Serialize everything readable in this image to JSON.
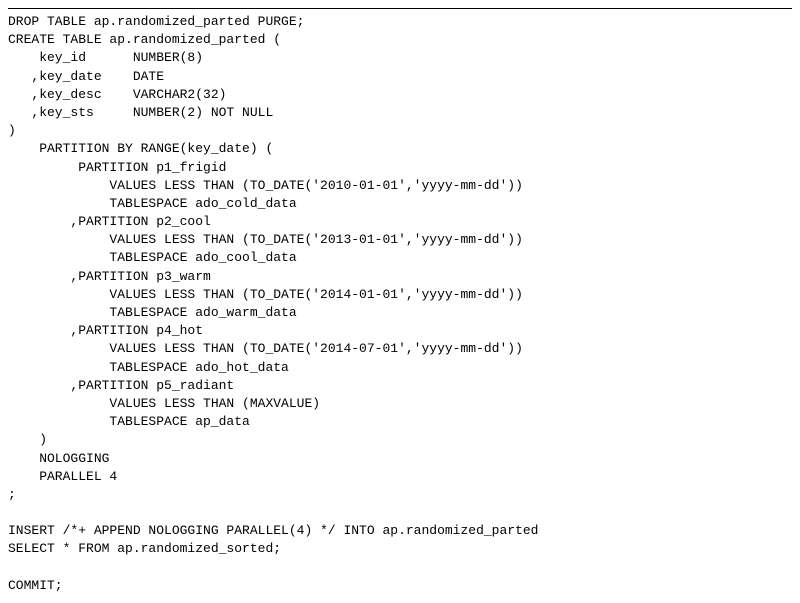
{
  "code": {
    "line01": "DROP TABLE ap.randomized_parted PURGE;",
    "line02": "CREATE TABLE ap.randomized_parted (",
    "line03": "    key_id      NUMBER(8)",
    "line04": "   ,key_date    DATE",
    "line05": "   ,key_desc    VARCHAR2(32)",
    "line06": "   ,key_sts     NUMBER(2) NOT NULL",
    "line07": ")",
    "line08": "    PARTITION BY RANGE(key_date) (",
    "line09": "         PARTITION p1_frigid",
    "line10": "             VALUES LESS THAN (TO_DATE('2010-01-01','yyyy-mm-dd'))",
    "line11": "             TABLESPACE ado_cold_data",
    "line12": "        ,PARTITION p2_cool",
    "line13": "             VALUES LESS THAN (TO_DATE('2013-01-01','yyyy-mm-dd'))",
    "line14": "             TABLESPACE ado_cool_data",
    "line15": "        ,PARTITION p3_warm",
    "line16": "             VALUES LESS THAN (TO_DATE('2014-01-01','yyyy-mm-dd'))",
    "line17": "             TABLESPACE ado_warm_data",
    "line18": "        ,PARTITION p4_hot",
    "line19": "             VALUES LESS THAN (TO_DATE('2014-07-01','yyyy-mm-dd'))",
    "line20": "             TABLESPACE ado_hot_data",
    "line21": "        ,PARTITION p5_radiant",
    "line22": "             VALUES LESS THAN (MAXVALUE)",
    "line23": "             TABLESPACE ap_data",
    "line24": "    )",
    "line25": "    NOLOGGING",
    "line26": "    PARALLEL 4",
    "line27": ";",
    "line28": "",
    "line29": "INSERT /*+ APPEND NOLOGGING PARALLEL(4) */ INTO ap.randomized_parted",
    "line30": "SELECT * FROM ap.randomized_sorted;",
    "line31": "",
    "line32": "COMMIT;"
  }
}
